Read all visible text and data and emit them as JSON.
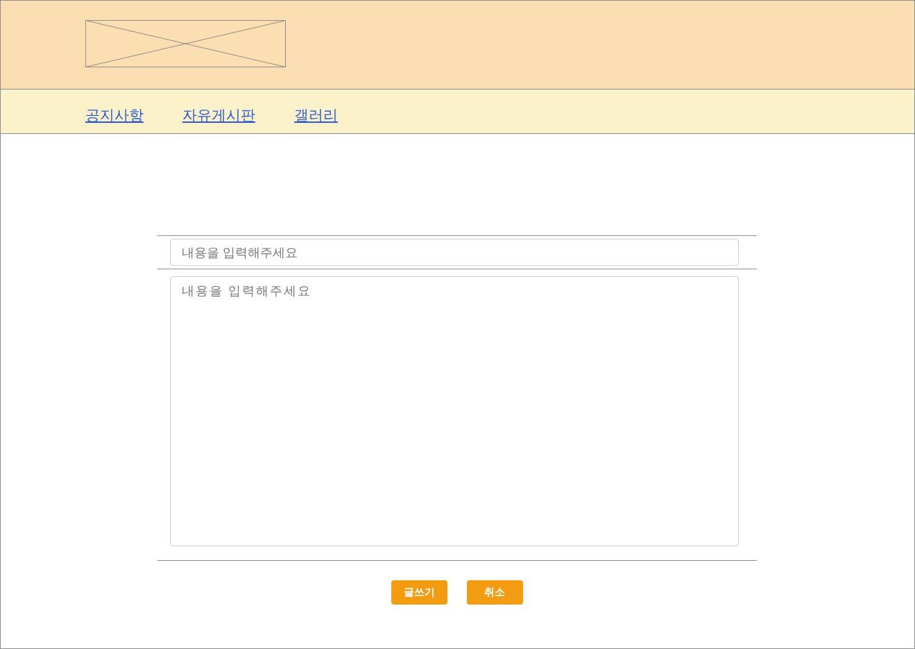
{
  "nav": [
    {
      "label": "공지사항"
    },
    {
      "label": "자유게시판"
    },
    {
      "label": "갤러리"
    }
  ],
  "form": {
    "title_placeholder": "내용을 입력해주세요",
    "body_placeholder": "내용을 입력해주세요"
  },
  "buttons": [
    {
      "label": "글쓰기"
    },
    {
      "label": "취소"
    }
  ]
}
